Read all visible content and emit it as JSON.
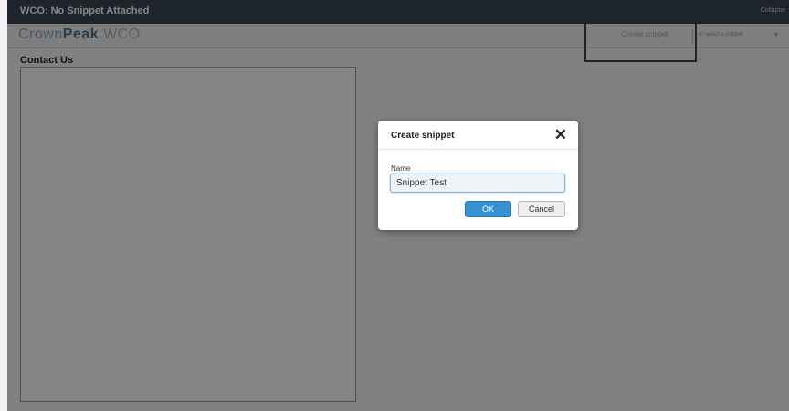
{
  "window": {
    "title": "WCO: No Snippet Attached",
    "collapse_label": "Collapse"
  },
  "brand": {
    "crown": "Crown",
    "peak": "Peak",
    "dot": ".",
    "wco": "WCO"
  },
  "toolbar": {
    "create_snippet_label": "Create snippet",
    "select_snippet_label": "or select a snippet",
    "caret": "▾"
  },
  "page": {
    "section_title": "Contact Us"
  },
  "dialog": {
    "title": "Create snippet",
    "close_glyph": "✕",
    "name_label": "Name",
    "name_value": "Snippet Test",
    "ok_label": "OK",
    "cancel_label": "Cancel"
  },
  "colors": {
    "topbar": "#3a4654",
    "accent_button": "#3691d4",
    "overlay": "rgba(0,0,0,0.48)"
  }
}
